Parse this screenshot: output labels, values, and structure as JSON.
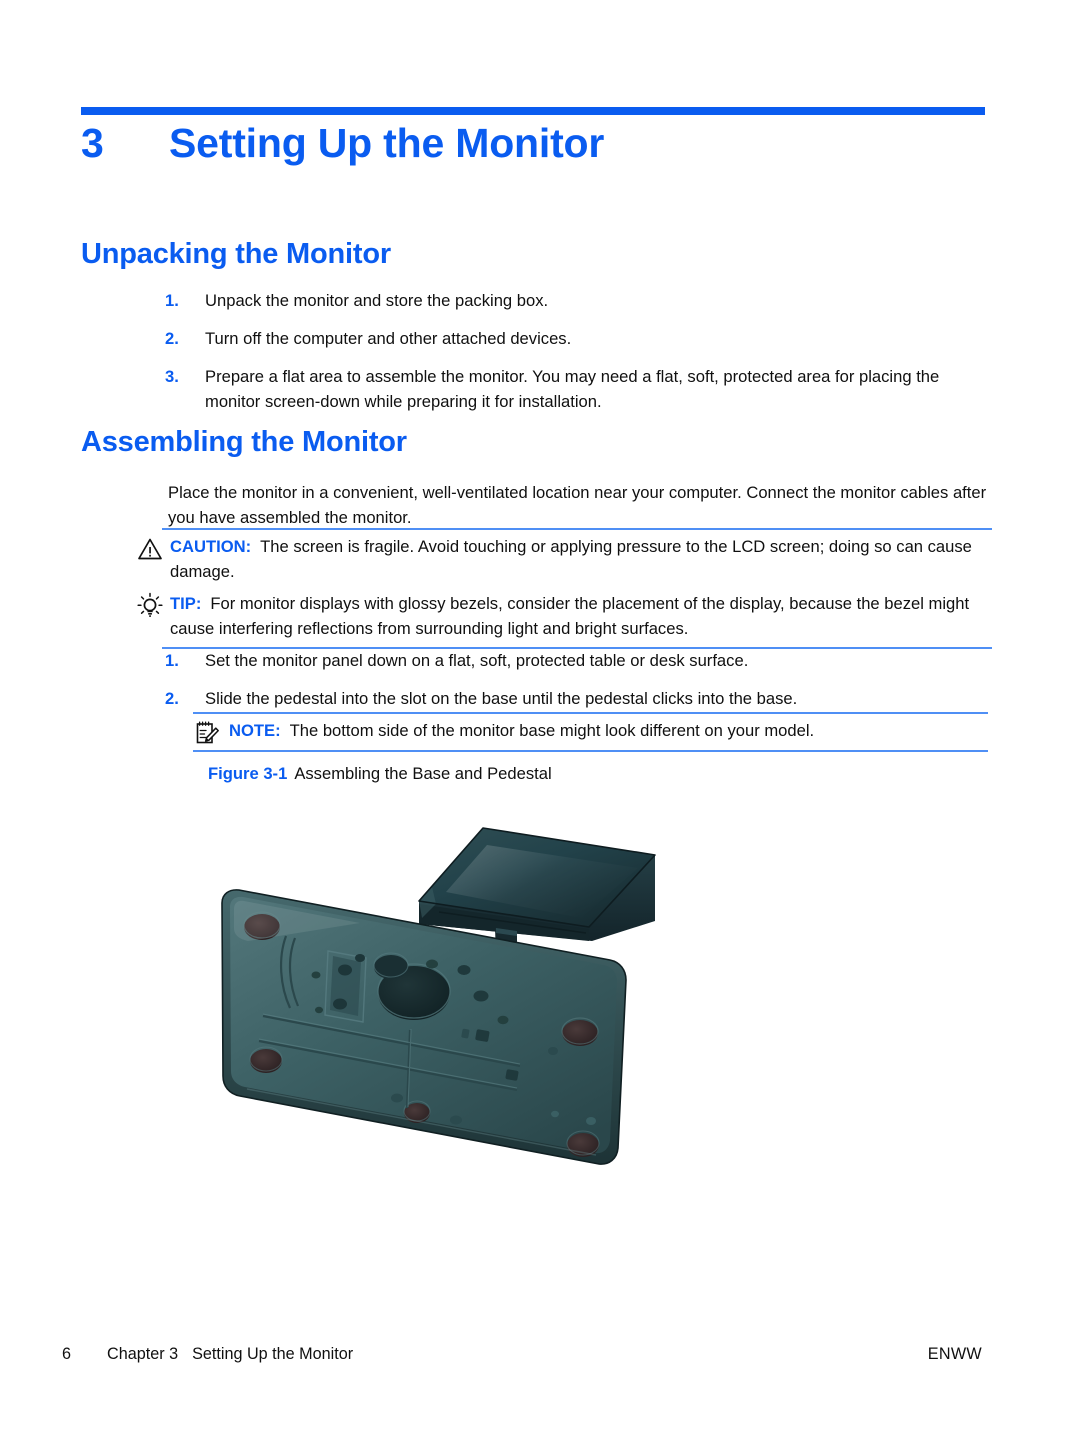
{
  "document": {
    "chapter_number": "3",
    "chapter_title": "Setting Up the Monitor",
    "accent_color": "#0a5cf0",
    "rule_color": "#4f8ff5",
    "text_color": "#101010"
  },
  "sections": {
    "unpacking": {
      "heading": "Unpacking the Monitor",
      "steps": [
        {
          "num": "1.",
          "text": "Unpack the monitor and store the packing box."
        },
        {
          "num": "2.",
          "text": "Turn off the computer and other attached devices."
        },
        {
          "num": "3.",
          "text": "Prepare a flat area to assemble the monitor. You may need a flat, soft, protected area for placing the monitor screen-down while preparing it for installation."
        }
      ]
    },
    "assembling": {
      "heading": "Assembling the Monitor",
      "intro": "Place the monitor in a convenient, well-ventilated location near your computer. Connect the monitor cables after you have assembled the monitor.",
      "caution": {
        "icon": "warning-triangle-icon",
        "label": "CAUTION:",
        "text": "The screen is fragile. Avoid touching or applying pressure to the LCD screen; doing so can cause damage."
      },
      "tip": {
        "icon": "lightbulb-icon",
        "label": "TIP:",
        "text": "For monitor displays with glossy bezels, consider the placement of the display, because the bezel might cause interfering reflections from surrounding light and bright surfaces."
      },
      "steps": [
        {
          "num": "1.",
          "text": "Set the monitor panel down on a flat, soft, protected table or desk surface."
        },
        {
          "num": "2.",
          "text": "Slide the pedestal into the slot on the base until the pedestal clicks into the base."
        }
      ],
      "note": {
        "icon": "notepad-pencil-icon",
        "label": "NOTE:",
        "text": "The bottom side of the monitor base might look different on your model."
      }
    }
  },
  "figure": {
    "number": "Figure 3-1",
    "caption": "Assembling the Base and Pedestal",
    "alt": "Exploded view of a monitor base, bottom side up, with the pedestal above it and an arrow showing the pedestal sliding into the slot on the base.",
    "colors": {
      "base_dark": "#22393c",
      "base_mid": "#35565a",
      "base_light": "#4a6f73",
      "pedestal_dark": "#182c30",
      "pedestal_mid": "#23424a"
    }
  },
  "footer": {
    "page_number": "6",
    "chapter_label": "Chapter 3",
    "chapter_title": "Setting Up the Monitor",
    "locale_code": "ENWW"
  }
}
